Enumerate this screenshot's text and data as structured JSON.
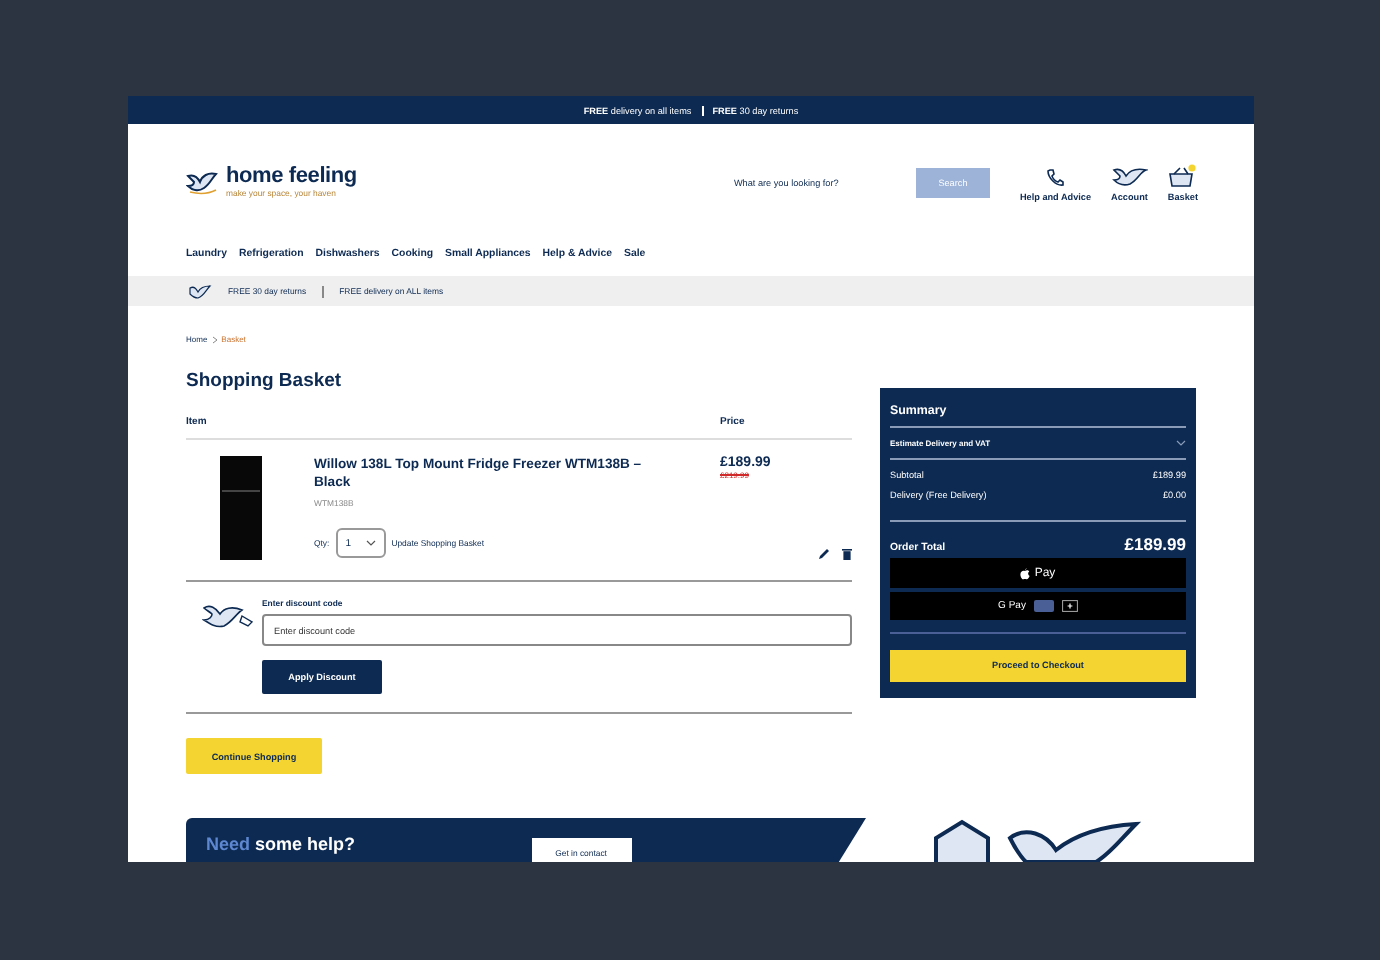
{
  "promo_bar": {
    "items": [
      "**FREE** delivery on all items",
      "**FREE** 30 day returns"
    ]
  },
  "header": {
    "logo": {
      "name": "home feeling",
      "tagline": "make your space, your haven"
    },
    "search": {
      "placeholder": "What are you looking for?",
      "button": "Search"
    },
    "links": [
      {
        "kind": "help",
        "label": "Help and Advice"
      },
      {
        "kind": "account",
        "label": "Account"
      },
      {
        "kind": "basket",
        "label": "Basket"
      }
    ]
  },
  "nav": [
    "Laundry",
    "Refrigeration",
    "Dishwashers",
    "Cooking",
    "Small Appliances",
    "Help & Advice",
    "Sale"
  ],
  "benefits": [
    "FREE 30 day returns",
    "FREE delivery on ALL items"
  ],
  "breadcrumb": [
    {
      "label": "Home",
      "selected": false
    },
    {
      "label": "Basket",
      "selected": true
    }
  ],
  "title": "Shopping Basket",
  "table": {
    "columns": [
      "Item",
      "Price"
    ],
    "rows": [
      {
        "name": "Willow 138L Top Mount Fridge Freezer WTM138B – Black",
        "sku": "WTM138B",
        "qty_label": "Qty:",
        "qty": "1",
        "update": "Update Shopping Basket",
        "price": "£189.99",
        "old_price": "£219.99"
      }
    ]
  },
  "discount": {
    "label": "Enter discount code",
    "placeholder": "Enter discount code",
    "button": "Apply Discount"
  },
  "continue_button": "Continue Shopping",
  "summary": {
    "title": "Summary",
    "estimate": "Estimate Delivery and VAT",
    "lines": [
      {
        "label": "Subtotal",
        "value": "£189.99"
      },
      {
        "label": "Delivery (Free Delivery)",
        "value": "£0.00"
      }
    ],
    "total_label": "Order Total",
    "total": "£189.99",
    "apple_pay": "Pay",
    "google_pay": "G Pay",
    "checkout": "Proceed to Checkout"
  },
  "help_banner": {
    "lead": "Need",
    "rest": "some help?",
    "button": "Get in contact"
  }
}
